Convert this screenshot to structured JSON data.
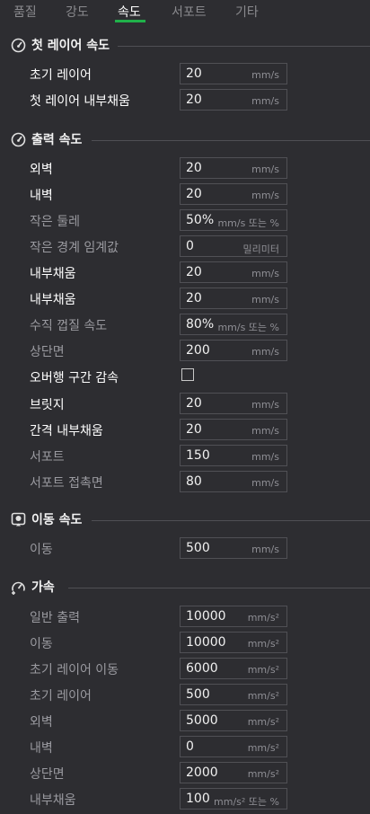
{
  "tabs": [
    "품질",
    "강도",
    "속도",
    "서포트",
    "기타"
  ],
  "sections": [
    {
      "title": "첫 레이어 속도",
      "icon": "speedometer-icon",
      "rows": [
        {
          "label": "초기 레이어",
          "value": "20",
          "unit": "mm/s"
        },
        {
          "label": "첫 레이어 내부채움",
          "value": "20",
          "unit": "mm/s"
        }
      ]
    },
    {
      "title": "출력 속도",
      "icon": "speedometer-icon",
      "rows": [
        {
          "label": "외벽",
          "value": "20",
          "unit": "mm/s"
        },
        {
          "label": "내벽",
          "value": "20",
          "unit": "mm/s"
        },
        {
          "label": "작은 둘레",
          "value": "50%",
          "unit": "mm/s 또는 %"
        },
        {
          "label": "작은 경계 임계값",
          "value": "0",
          "unit": "밀리미터"
        },
        {
          "label": "내부채움",
          "value": "20",
          "unit": "mm/s"
        },
        {
          "label": "내부채움",
          "value": "20",
          "unit": "mm/s"
        },
        {
          "label": "수직 껍질 속도",
          "value": "80%",
          "unit": "mm/s 또는 %"
        },
        {
          "label": "상단면",
          "value": "200",
          "unit": "mm/s"
        },
        {
          "label": "오버행 구간 감속",
          "checkbox": true,
          "checked": false
        },
        {
          "label": "브릿지",
          "value": "20",
          "unit": "mm/s"
        },
        {
          "label": "간격 내부채움",
          "value": "20",
          "unit": "mm/s"
        },
        {
          "label": "서포트",
          "value": "150",
          "unit": "mm/s"
        },
        {
          "label": "서포트 접촉면",
          "value": "80",
          "unit": "mm/s"
        }
      ]
    },
    {
      "title": "이동 속도",
      "icon": "travel-icon",
      "rows": [
        {
          "label": "이동",
          "value": "500",
          "unit": "mm/s"
        }
      ]
    },
    {
      "title": "가속",
      "icon": "acceleration-icon",
      "rows": [
        {
          "label": "일반 출력",
          "value": "10000",
          "unit": "mm/s²"
        },
        {
          "label": "이동",
          "value": "10000",
          "unit": "mm/s²"
        },
        {
          "label": "초기 레이어 이동",
          "value": "6000",
          "unit": "mm/s²"
        },
        {
          "label": "초기 레이어",
          "value": "500",
          "unit": "mm/s²"
        },
        {
          "label": "외벽",
          "value": "5000",
          "unit": "mm/s²"
        },
        {
          "label": "내벽",
          "value": "0",
          "unit": "mm/s²"
        },
        {
          "label": "상단면",
          "value": "2000",
          "unit": "mm/s²"
        },
        {
          "label": "내부채움",
          "value": "100",
          "unit": "mm/s² 또는 %"
        }
      ]
    }
  ],
  "colors": {
    "accent": "#20b14a",
    "background": "#2d2d31"
  }
}
